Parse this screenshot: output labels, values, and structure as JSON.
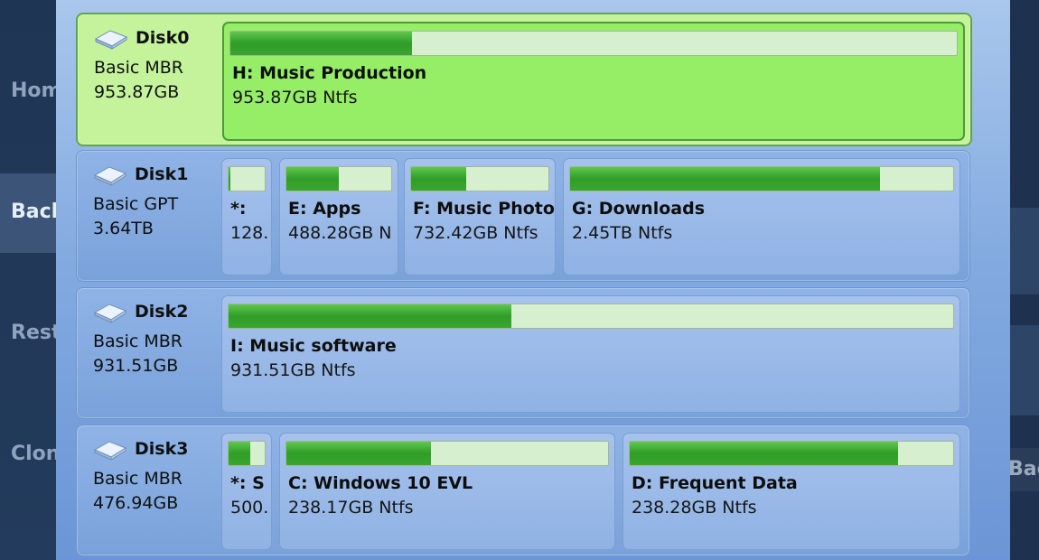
{
  "background": {
    "nav": [
      {
        "label": "Home",
        "active": false
      },
      {
        "label": "Backup",
        "active": true
      },
      {
        "label": "Restore",
        "active": false
      },
      {
        "label": "Clone",
        "active": false
      }
    ],
    "right_button": "Back"
  },
  "disks": [
    {
      "name": "Disk0",
      "type": "Basic MBR",
      "size": "953.87GB",
      "selected": true,
      "partitions": [
        {
          "label": "H: Music Production",
          "fs": "953.87GB Ntfs",
          "used": 0.25,
          "selected": true
        }
      ]
    },
    {
      "name": "Disk1",
      "type": "Basic GPT",
      "size": "3.64TB",
      "selected": false,
      "partitions": [
        {
          "label": "*:",
          "fs": "128.",
          "used": 0.05
        },
        {
          "label": "E: Apps",
          "fs": "488.28GB N",
          "used": 0.5
        },
        {
          "label": "F: Music Photo",
          "fs": "732.42GB Ntfs",
          "used": 0.4
        },
        {
          "label": "G: Downloads",
          "fs": "2.45TB Ntfs",
          "used": 0.81
        }
      ]
    },
    {
      "name": "Disk2",
      "type": "Basic MBR",
      "size": "931.51GB",
      "selected": false,
      "partitions": [
        {
          "label": "I: Music software",
          "fs": "931.51GB Ntfs",
          "used": 0.39
        }
      ]
    },
    {
      "name": "Disk3",
      "type": "Basic MBR",
      "size": "476.94GB",
      "selected": false,
      "partitions": [
        {
          "label": "*: S",
          "fs": "500.",
          "used": 0.6
        },
        {
          "label": "C: Windows 10 EVL",
          "fs": "238.17GB Ntfs",
          "used": 0.45
        },
        {
          "label": "D: Frequent Data",
          "fs": "238.28GB Ntfs",
          "used": 0.83
        }
      ]
    }
  ],
  "colors": {
    "panel": "#84abe0",
    "selected_partition": "#95ee66",
    "bar_fill": "#2f9d27",
    "bar_track": "#d6efcf"
  }
}
